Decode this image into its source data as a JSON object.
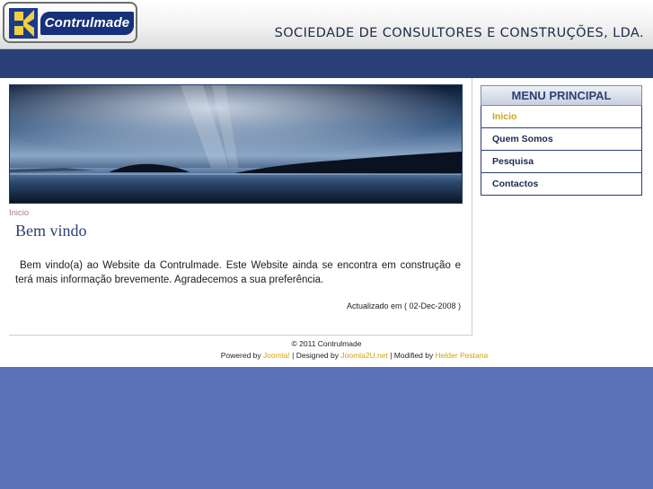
{
  "header": {
    "logo_text": "Contrulmade",
    "company_name": "SOCIEDADE DE CONSULTORES E CONSTRUÇÕES, LDA."
  },
  "content": {
    "breadcrumb": "Inicio",
    "title": "Bem vindo",
    "body": "Bem vindo(a) ao Website da Contrulmade. Este Website ainda se encontra em construção e terá mais informação brevemente. Agradecemos a sua preferência.",
    "updated": "Actualizado em ( 02-Dec-2008 )"
  },
  "sidebar": {
    "header": "MENU PRINCIPAL",
    "items": [
      {
        "label": "Inicio",
        "active": true
      },
      {
        "label": "Quem Somos"
      },
      {
        "label": "Pesquisa"
      },
      {
        "label": "Contactos"
      }
    ]
  },
  "footer": {
    "copyright": "© 2011 Contrulmade",
    "powered_prefix": "Powered by",
    "powered_link": "Joomla!",
    "designed_prefix": "| Designed by",
    "designed_link": "Joomla2U.net",
    "modified_prefix": "| Modified by",
    "modified_link": "Helder Pestana"
  },
  "colors": {
    "accent": "#2a3f78",
    "link": "#d8a000",
    "background": "#5a72b8"
  }
}
